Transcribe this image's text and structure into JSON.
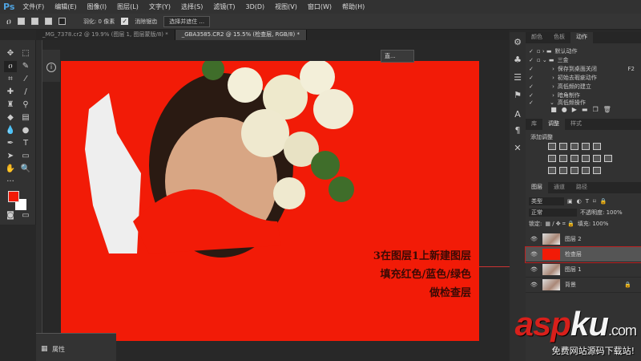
{
  "app": {
    "logo": "Ps"
  },
  "menu": [
    "文件(F)",
    "编辑(E)",
    "图像(I)",
    "图层(L)",
    "文字(Y)",
    "选择(S)",
    "滤镜(T)",
    "3D(D)",
    "视图(V)",
    "窗口(W)",
    "帮助(H)"
  ],
  "options": {
    "feather_label": "羽化: 0 像素",
    "antialias_label": "消除锯齿",
    "select_mask_button": "选择并遮住 ..."
  },
  "tabs": [
    "_MG_7378.cr2 @ 19.9% (图层 1, 图层蒙版/8) *",
    "_GBA3585.CR2 @ 15.5% (检查层, RGB/8) *"
  ],
  "colors": {
    "foreground": "#f21b07",
    "background": "#ffffff",
    "document": "#f21b07"
  },
  "tooltip": "直...",
  "annotation": [
    "3在图层1上新建图层",
    "填充红色/蓝色/绿色",
    "做检查层"
  ],
  "properties_panel": {
    "title": "属性"
  },
  "actions_panel": {
    "tabs": [
      "颜色",
      "色板",
      "动作"
    ],
    "items": [
      {
        "label": "默认动作",
        "type": "set"
      },
      {
        "label": "三金",
        "type": "set"
      },
      {
        "label": "保存到桌面关闭",
        "shortcut": "F2"
      },
      {
        "label": "初始去瑕疵动作"
      },
      {
        "label": "高低频的建立"
      },
      {
        "label": "暗角制作"
      },
      {
        "label": "高低频操作"
      }
    ]
  },
  "adjust_panel": {
    "tabs": [
      "库",
      "调整",
      "样式"
    ],
    "add_label": "添加调整"
  },
  "layers_panel": {
    "tabs": [
      "图层",
      "通道",
      "路径"
    ],
    "filter": "类型",
    "blend_mode": "正常",
    "opacity_label": "不透明度: 100%",
    "lock_label": "锁定:",
    "fill_label": "填充: 100%",
    "layers": [
      {
        "name": "图层 2"
      },
      {
        "name": "检查层",
        "selected": true
      },
      {
        "name": "图层 1"
      },
      {
        "name": "背景",
        "locked": true
      }
    ]
  },
  "watermark": {
    "brand_a": "asp",
    "brand_b": "ku",
    "suffix": ".com",
    "tagline": "免费网站源码下载站!"
  }
}
